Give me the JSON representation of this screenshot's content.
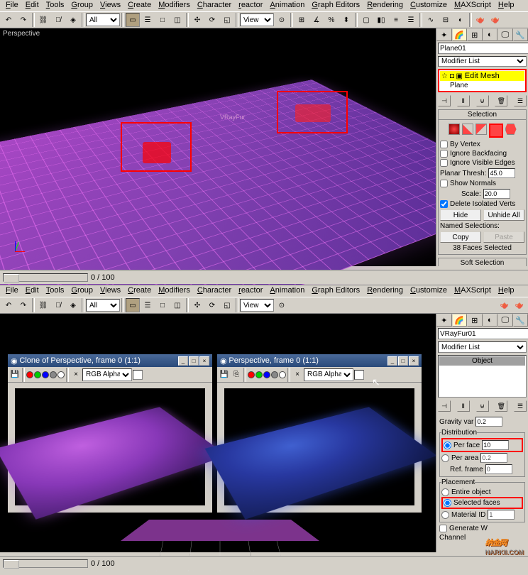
{
  "menu": [
    "File",
    "Edit",
    "Tools",
    "Group",
    "Views",
    "Create",
    "Modifiers",
    "Character",
    "reactor",
    "Animation",
    "Graph Editors",
    "Rendering",
    "Customize",
    "MAXScript",
    "Help"
  ],
  "toolbar": {
    "combo_all": "All",
    "combo_view": "View"
  },
  "top": {
    "viewport_label": "Perspective",
    "vray_label": "VRayFur",
    "status_frames": "0 / 100",
    "object_name": "Plane01",
    "object_color": "#ff30ff",
    "modifier_list_label": "Modifier List",
    "stack": {
      "active": "Edit Mesh",
      "below": "Plane"
    },
    "selection": {
      "title": "Selection",
      "by_vertex": "By Vertex",
      "ignore_backfacing": "Ignore Backfacing",
      "ignore_visible": "Ignore Visible Edges",
      "planar_thresh": "Planar Thresh:",
      "planar_val": "45.0",
      "show_normals": "Show Normals",
      "scale": "Scale:",
      "scale_val": "20.0",
      "delete_isolated": "Delete Isolated Verts",
      "hide": "Hide",
      "unhide": "Unhide All",
      "named": "Named Selections:",
      "copy": "Copy",
      "paste": "Paste",
      "faces_selected": "38 Faces Selected"
    },
    "soft_sel": "Soft Selection"
  },
  "render": {
    "win1_title": "Clone of Perspective, frame 0 (1:1)",
    "win2_title": "Perspective, frame 0 (1:1)",
    "channel": "RGB Alpha"
  },
  "bottom": {
    "status_frames": "0 / 100",
    "object_name": "VRayFur01",
    "object_color": "#3050ff",
    "modifier_list_label": "Modifier List",
    "stack_item": "Object",
    "params": {
      "gravity": "Gravity var",
      "gravity_val": "0.2",
      "dist": "Distribution",
      "per_face": "Per face",
      "per_face_val": "10",
      "per_area": "Per area",
      "per_area_val": "0.2",
      "ref_frame": "Ref. frame",
      "ref_frame_val": "0",
      "placement": "Placement",
      "entire": "Entire object",
      "selected_faces": "Selected faces",
      "material_id": "Material ID",
      "material_id_val": "1",
      "generate": "Generate W",
      "channel": "Channel"
    }
  },
  "watermark": {
    "brand": "纳金网",
    "url": "NARKII.COM"
  }
}
